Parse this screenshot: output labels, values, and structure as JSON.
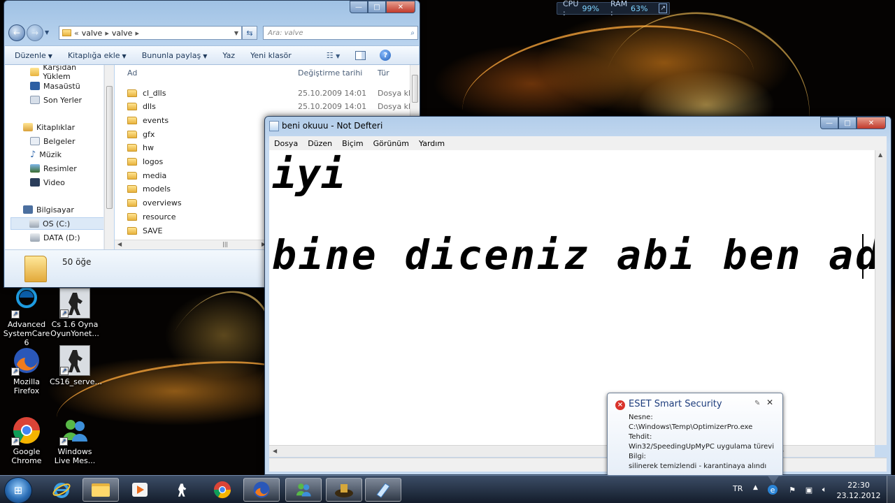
{
  "resource_monitor": {
    "cpu_label": "CPU :",
    "cpu_value": "99%",
    "ram_label": "RAM :",
    "ram_value": "63%"
  },
  "desktop_icons": [
    {
      "label": "Advanced SystemCare 6",
      "icon": "advanced-systemcare-icon"
    },
    {
      "label": "Cs 1.6 Oyna OyunYonet...",
      "icon": "counter-strike-icon"
    },
    {
      "label": "Mozilla Firefox",
      "icon": "firefox-icon"
    },
    {
      "label": "CS16_serve...",
      "icon": "counter-strike-icon"
    },
    {
      "label": "Google Chrome",
      "icon": "chrome-icon"
    },
    {
      "label": "Windows Live Mes...",
      "icon": "windows-live-messenger-icon"
    }
  ],
  "explorer": {
    "breadcrumb": [
      "valve",
      "valve"
    ],
    "search_placeholder": "Ara: valve",
    "toolbar": [
      "Düzenle",
      "Kitaplığa ekle",
      "Bununla paylaş",
      "Yaz",
      "Yeni klasör"
    ],
    "nav_items": [
      "Karşıdan Yüklem",
      "Masaüstü",
      "Son Yerler",
      "Kitaplıklar",
      "Belgeler",
      "Müzik",
      "Resimler",
      "Video",
      "Bilgisayar",
      "OS (C:)",
      "DATA (D:)"
    ],
    "columns": {
      "name": "Ad",
      "date": "Değiştirme tarihi",
      "type": "Tür"
    },
    "files": [
      {
        "name": "cl_dlls",
        "date": "25.10.2009 14:01",
        "type": "Dosya kla"
      },
      {
        "name": "dlls",
        "date": "25.10.2009 14:01",
        "type": "Dosya kla"
      },
      {
        "name": "events",
        "date": "",
        "type": ""
      },
      {
        "name": "gfx",
        "date": "",
        "type": ""
      },
      {
        "name": "hw",
        "date": "",
        "type": ""
      },
      {
        "name": "logos",
        "date": "",
        "type": ""
      },
      {
        "name": "media",
        "date": "",
        "type": ""
      },
      {
        "name": "models",
        "date": "",
        "type": ""
      },
      {
        "name": "overviews",
        "date": "",
        "type": ""
      },
      {
        "name": "resource",
        "date": "",
        "type": ""
      },
      {
        "name": "SAVE",
        "date": "",
        "type": ""
      }
    ],
    "item_count": "50 öğe"
  },
  "notepad": {
    "title": "beni okuuu - Not Defteri",
    "menu": [
      "Dosya",
      "Düzen",
      "Biçim",
      "Görünüm",
      "Yardım"
    ],
    "line1": "iyi",
    "line2": "bine diceniz abi ben ad"
  },
  "eset": {
    "title": "ESET Smart Security",
    "object_label": "Nesne:",
    "object_value": "C:\\Windows\\Temp\\OptimizerPro.exe",
    "threat_label": "Tehdit:",
    "threat_value": "Win32/SpeedingUpMyPC uygulama türevi",
    "info_label": "Bilgi:",
    "info_value": "silinerek temizlendi - karantinaya alındı"
  },
  "taskbar": {
    "pinned": [
      "internet-explorer-icon",
      "explorer-folder-icon",
      "media-player-icon",
      "counter-strike-icon",
      "chrome-icon",
      "firefox-icon",
      "messenger-icon",
      "game-icon",
      "notepad-icon"
    ],
    "language": "TR",
    "time": "22:30",
    "date": "23.12.2012"
  }
}
